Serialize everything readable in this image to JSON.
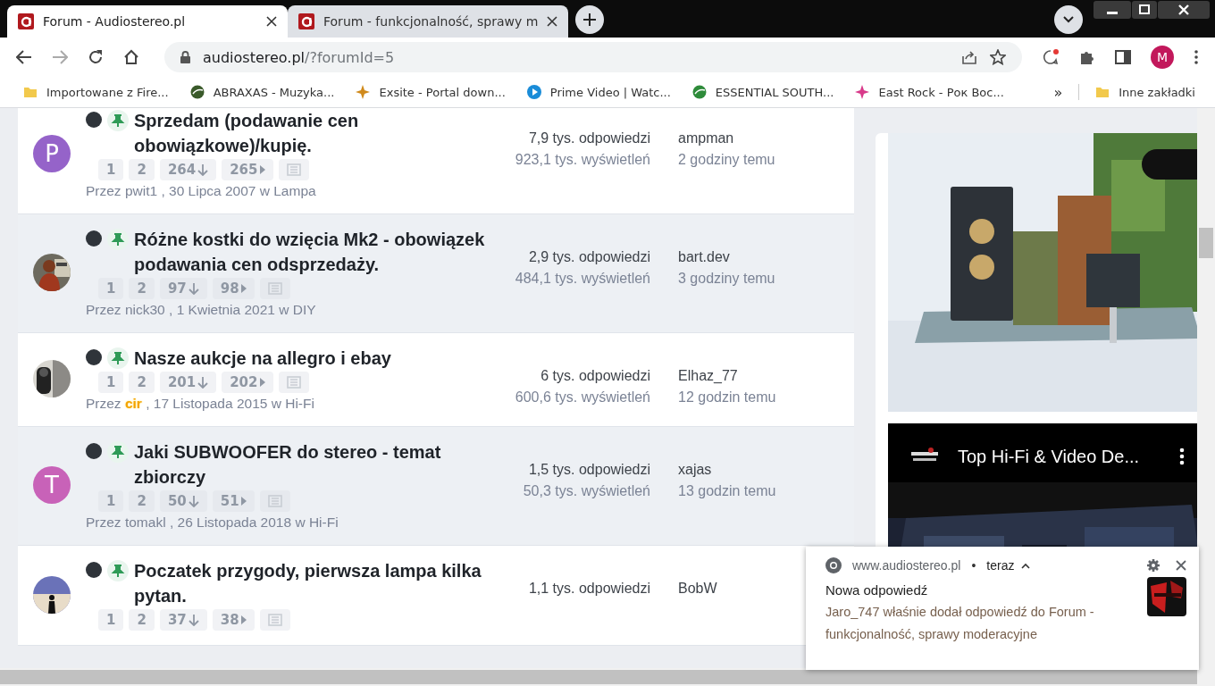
{
  "browser": {
    "tabs": [
      {
        "title": "Forum - Audiostereo.pl",
        "selected": true
      },
      {
        "title": "Forum - funkcjonalność, sprawy m",
        "selected": false
      }
    ],
    "address": {
      "host": "audiostereo.pl",
      "path": "/?forumId=5"
    },
    "profile_initial": "M",
    "bookmarks": [
      {
        "label": "Importowane z Fire...",
        "kind": "folder",
        "color": "#f2c94c"
      },
      {
        "label": "ABRAXAS - Muzyka...",
        "kind": "site",
        "color": "#3a5a2a"
      },
      {
        "label": "Exsite - Portal down...",
        "kind": "star",
        "color": "#d08a1c"
      },
      {
        "label": "Prime Video | Watc...",
        "kind": "play",
        "color": "#1a8cd8"
      },
      {
        "label": "ESSENTIAL SOUTH...",
        "kind": "site",
        "color": "#2e8b3a"
      },
      {
        "label": "East Rock - Рок Вос...",
        "kind": "star",
        "color": "#d83a8a"
      }
    ],
    "more_bookmarks": "»",
    "other_bookmarks": {
      "label": "Inne zakładki",
      "kind": "folder",
      "color": "#f2c94c"
    }
  },
  "topics": [
    {
      "avatar": {
        "kind": "letter",
        "letter": "P",
        "color": "#9563c9"
      },
      "unread": true,
      "pinned": true,
      "title": "Sprzedam (podawanie cen obowiązkowe)/kupię.",
      "pages": [
        {
          "label": "1",
          "kind": "page"
        },
        {
          "label": "2",
          "kind": "page"
        },
        {
          "label": "264",
          "kind": "unread"
        },
        {
          "label": "265",
          "kind": "last"
        },
        {
          "kind": "preview"
        }
      ],
      "byline": {
        "prefix": "Przez",
        "author": "pwit1",
        "author_highlighted": false,
        "rest": ", 30 Lipca 2007 w Lampa"
      },
      "replies": "7,9 tys. odpowiedzi",
      "views": "923,1 tys. wyświetleń",
      "last_poster": "ampman",
      "last_time": "2 godziny temu"
    },
    {
      "avatar": {
        "kind": "picture"
      },
      "unread": true,
      "pinned": true,
      "title": "Różne kostki do wzięcia Mk2 - obowiązek podawania cen odsprzedaży.",
      "pages": [
        {
          "label": "1",
          "kind": "page"
        },
        {
          "label": "2",
          "kind": "page"
        },
        {
          "label": "97",
          "kind": "unread"
        },
        {
          "label": "98",
          "kind": "last"
        },
        {
          "kind": "preview"
        }
      ],
      "byline": {
        "prefix": "Przez",
        "author": "nick30",
        "author_highlighted": false,
        "rest": ", 1 Kwietnia 2021 w DIY"
      },
      "replies": "2,9 tys. odpowiedzi",
      "views": "484,1 tys. wyświetleń",
      "last_poster": "bart.dev",
      "last_time": "3 godziny temu"
    },
    {
      "avatar": {
        "kind": "picture"
      },
      "unread": true,
      "pinned": true,
      "title": "Nasze aukcje na allegro i ebay",
      "pages": [
        {
          "label": "1",
          "kind": "page"
        },
        {
          "label": "2",
          "kind": "page"
        },
        {
          "label": "201",
          "kind": "unread"
        },
        {
          "label": "202",
          "kind": "last"
        },
        {
          "kind": "preview"
        }
      ],
      "byline": {
        "prefix": "Przez",
        "author": "cir",
        "author_highlighted": true,
        "rest": ", 17 Listopada 2015 w Hi-Fi"
      },
      "replies": "6 tys. odpowiedzi",
      "views": "600,6 tys. wyświetleń",
      "last_poster": "Elhaz_77",
      "last_time": "12 godzin temu"
    },
    {
      "avatar": {
        "kind": "letter",
        "letter": "T",
        "color": "#c862b8"
      },
      "unread": true,
      "pinned": true,
      "title": "Jaki SUBWOOFER do stereo - temat zbiorczy",
      "pages": [
        {
          "label": "1",
          "kind": "page"
        },
        {
          "label": "2",
          "kind": "page"
        },
        {
          "label": "50",
          "kind": "unread"
        },
        {
          "label": "51",
          "kind": "last"
        },
        {
          "kind": "preview"
        }
      ],
      "byline": {
        "prefix": "Przez",
        "author": "tomakl",
        "author_highlighted": false,
        "rest": ", 26 Listopada 2018 w Hi-Fi"
      },
      "replies": "1,5 tys. odpowiedzi",
      "views": "50,3 tys. wyświetleń",
      "last_poster": "xajas",
      "last_time": "13 godzin temu"
    },
    {
      "avatar": {
        "kind": "picture"
      },
      "unread": true,
      "pinned": true,
      "title": "Poczatek przygody, pierwsza lampa kilka pytan.",
      "pages": [
        {
          "label": "1",
          "kind": "page"
        },
        {
          "label": "2",
          "kind": "page"
        },
        {
          "label": "37",
          "kind": "unread"
        },
        {
          "label": "38",
          "kind": "last"
        },
        {
          "kind": "preview"
        }
      ],
      "replies": "1,1 tys. odpowiedzi",
      "last_poster": "BobW"
    }
  ],
  "sidebar": {
    "ad": {
      "kind": "picture"
    },
    "video": {
      "title": "Top Hi-Fi & Video De..."
    }
  },
  "notification": {
    "source": "www.audiostereo.pl",
    "separator": "•",
    "time": "teraz",
    "title": "Nowa odpowiedź",
    "body": "Jaro_747 właśnie dodał odpowiedź do Forum - funkcjonalność, sprawy moderacyjne"
  }
}
